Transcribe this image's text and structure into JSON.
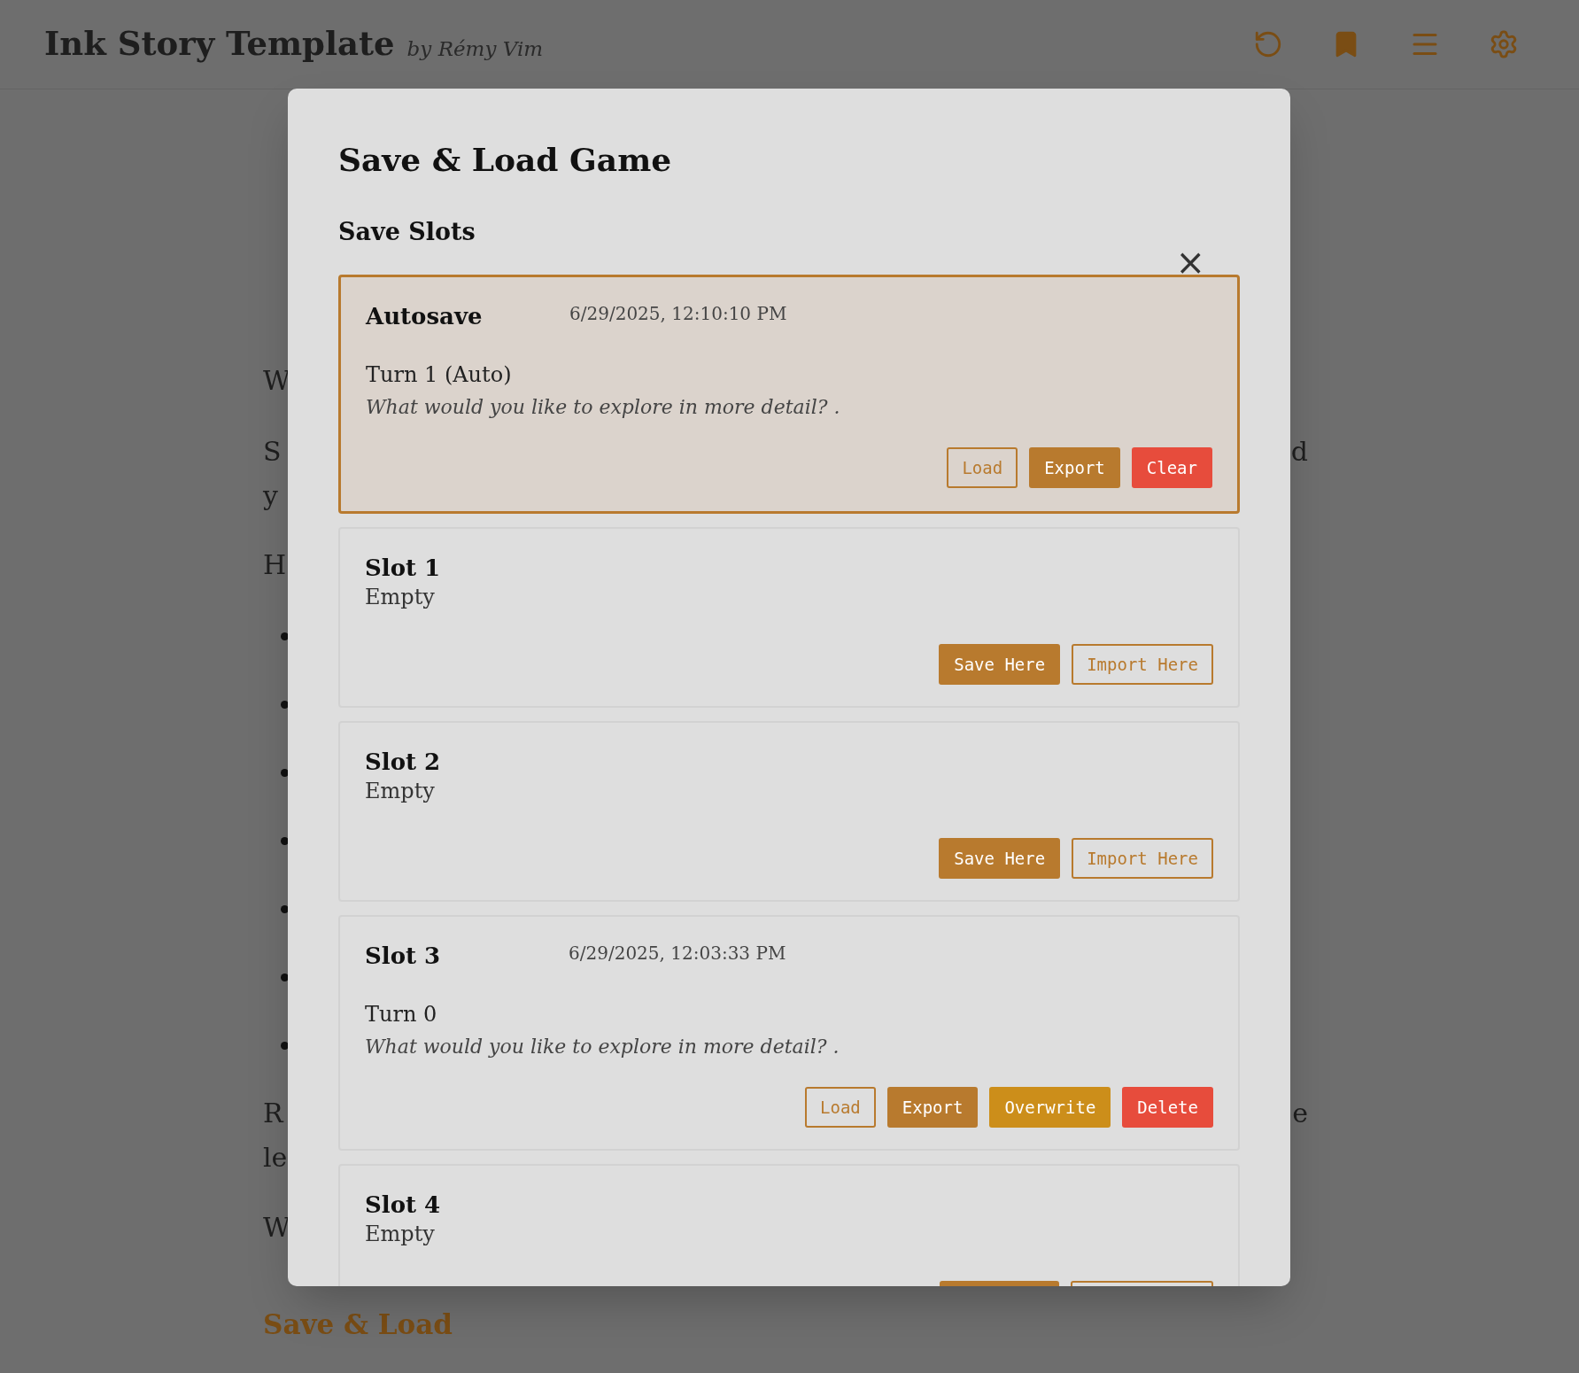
{
  "header": {
    "title": "Ink Story Template",
    "byline": "by Rémy Vim"
  },
  "background": {
    "lines": [
      {
        "left": "W"
      },
      {
        "left": "S",
        "right": "d"
      },
      {
        "left": "y"
      },
      {
        "left": "H"
      },
      {
        "left": "R",
        "right": "e"
      },
      {
        "left": "le"
      },
      {
        "left": "W"
      }
    ],
    "link": "Save & Load"
  },
  "modal": {
    "title": "Save & Load Game",
    "close": "×",
    "section": "Save Slots",
    "slots": [
      {
        "name": "Autosave",
        "date": "6/29/2025, 12:10:10 PM",
        "turn": "Turn 1 (Auto)",
        "excerpt": "What would you like to explore in more detail? .",
        "highlighted": true,
        "buttons": [
          {
            "label": "Load",
            "kind": "outline"
          },
          {
            "label": "Export",
            "kind": "primary"
          },
          {
            "label": "Clear",
            "kind": "danger"
          }
        ]
      },
      {
        "name": "Slot 1",
        "status": "Empty",
        "highlighted": false,
        "buttons": [
          {
            "label": "Save Here",
            "kind": "primary"
          },
          {
            "label": "Import Here",
            "kind": "outline"
          }
        ]
      },
      {
        "name": "Slot 2",
        "status": "Empty",
        "highlighted": false,
        "buttons": [
          {
            "label": "Save Here",
            "kind": "primary"
          },
          {
            "label": "Import Here",
            "kind": "outline"
          }
        ]
      },
      {
        "name": "Slot 3",
        "date": "6/29/2025, 12:03:33 PM",
        "turn": "Turn 0",
        "excerpt": "What would you like to explore in more detail? .",
        "highlighted": false,
        "buttons": [
          {
            "label": "Load",
            "kind": "outline"
          },
          {
            "label": "Export",
            "kind": "primary"
          },
          {
            "label": "Overwrite",
            "kind": "warning"
          },
          {
            "label": "Delete",
            "kind": "danger"
          }
        ]
      },
      {
        "name": "Slot 4",
        "status": "Empty",
        "highlighted": false,
        "buttons": [
          {
            "kind": "primary"
          },
          {
            "kind": "outline"
          }
        ]
      }
    ]
  }
}
